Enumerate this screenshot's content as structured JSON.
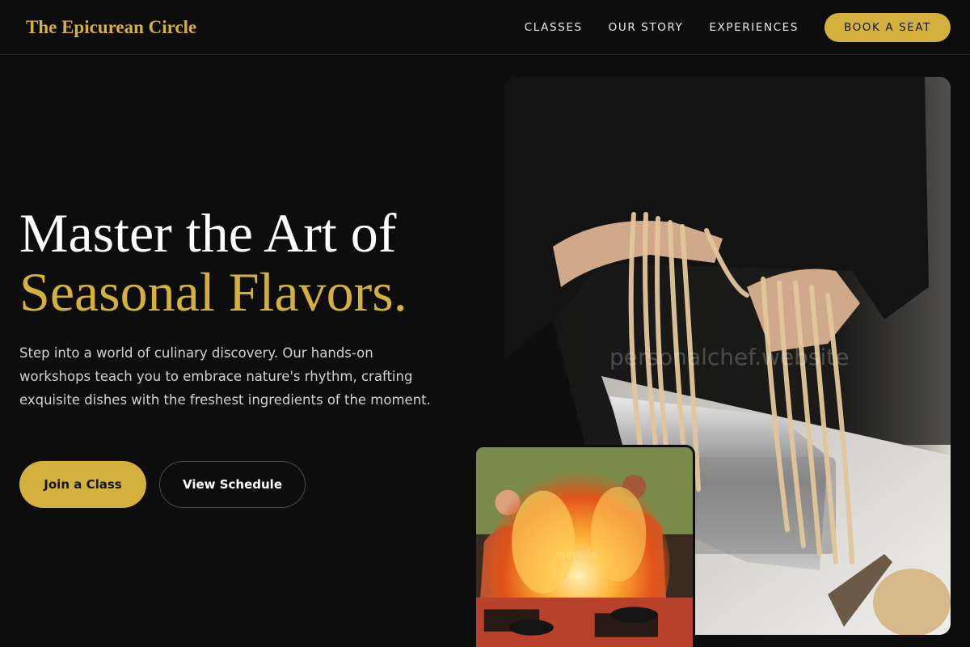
{
  "header": {
    "logo": "The Epicurean Circle",
    "nav": [
      "CLASSES",
      "OUR STORY",
      "EXPERIENCES"
    ],
    "cta": "BOOK A SEAT"
  },
  "hero": {
    "title_line1": "Master the Art of",
    "title_line2": "Seasonal Flavors.",
    "intro": "Step into a world of culinary discovery. Our hands-on workshops teach you to embrace nature's rhythm, crafting exquisite dishes with the freshest ingredients of the moment.",
    "primary_cta": "Join a Class",
    "secondary_cta": "View Schedule"
  },
  "images": {
    "main_watermark": "personalchef.website",
    "small_watermark": "website"
  },
  "colors": {
    "accent": "#d4b13f",
    "background": "#0d0d0d"
  }
}
